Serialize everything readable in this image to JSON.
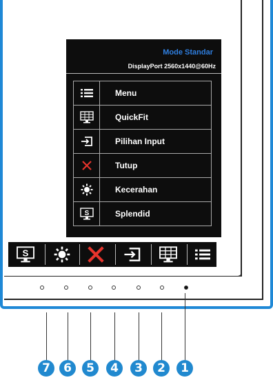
{
  "osd": {
    "mode_title": "Mode Standar",
    "signal_info": "DisplayPort  2560x1440@60Hz",
    "menu_items": [
      {
        "label": "Menu",
        "icon": "menu-list-icon"
      },
      {
        "label": "QuickFit",
        "icon": "quickfit-grid-icon"
      },
      {
        "label": "Pilihan Input",
        "icon": "input-select-icon"
      },
      {
        "label": "Tutup",
        "icon": "close-x-icon"
      },
      {
        "label": "Kecerahan",
        "icon": "brightness-icon"
      },
      {
        "label": "Splendid",
        "icon": "splendid-icon"
      }
    ]
  },
  "keybar": {
    "keys": [
      "splendid-icon",
      "brightness-icon",
      "close-x-icon",
      "input-select-icon",
      "quickfit-grid-icon",
      "menu-list-icon"
    ]
  },
  "buttons": {
    "numbers": [
      "7",
      "6",
      "5",
      "4",
      "3",
      "2",
      "1"
    ]
  },
  "colors": {
    "accent": "#2189cf",
    "title_blue": "#2f7fe0",
    "close_red": "#e8342c",
    "osd_bg": "#0d0d0d"
  }
}
